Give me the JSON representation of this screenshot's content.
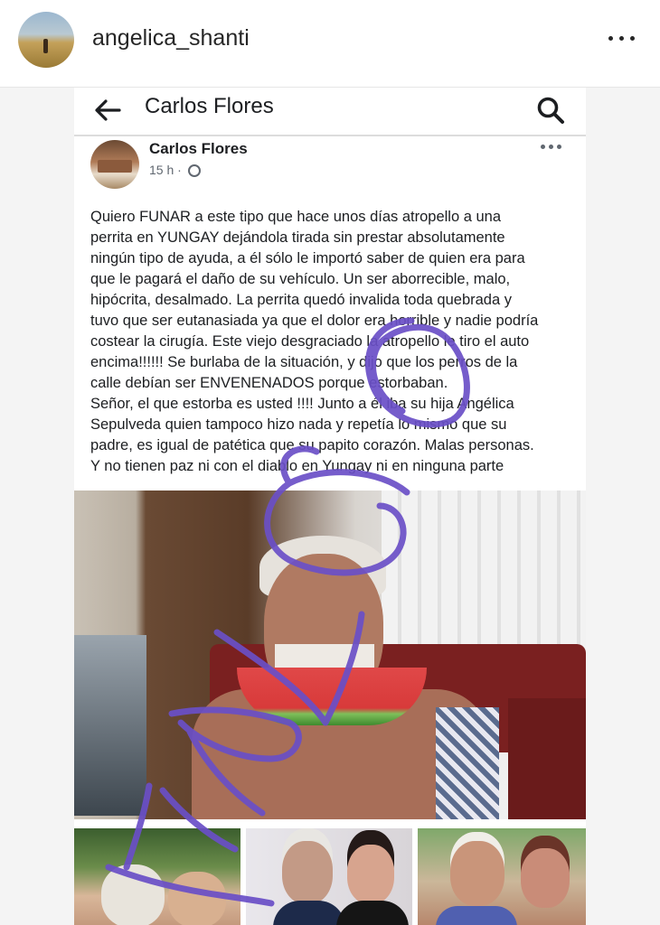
{
  "instagram": {
    "username": "angelica_shanti",
    "more_icon": "more-horizontal-icon"
  },
  "facebook": {
    "header_title": "Carlos Flores",
    "back_icon": "arrow-left-icon",
    "search_icon": "search-icon",
    "post": {
      "author": "Carlos Flores",
      "time": "15 h ·",
      "privacy_icon": "globe-icon",
      "text_lines": [
        "Quiero FUNAR  a este tipo que hace unos días atropello a una",
        "perrita en YUNGAY dejándola tirada sin prestar absolutamente",
        "ningún tipo de ayuda, a él sólo le importó saber de quien era para",
        "que le pagará el daño de su vehículo. Un ser aborrecible, malo,",
        "hipócrita, desalmado. La perrita quedó invalida toda quebrada y",
        "tuvo que ser eutanasiada ya que el dolor era horrible y nadie podría",
        "costear la cirugía. Este viejo desgraciado la atropello le tiro el auto",
        "encima!!!!!!  Se burlaba de la situación, y dijo que los perros de la",
        "calle debían ser ENVENENADOS porque estorbaban.",
        "Señor, el que estorba es usted !!!! Junto a él iba su hija Angélica",
        "Sepulveda quien tampoco hizo nada y repetía lo mismo que su",
        "padre, es igual de patética que su papito corazón. Malas personas.",
        "Y no tienen paz  ni con el diablo en Yungay ni en ninguna parte"
      ]
    }
  },
  "colors": {
    "scribble": "#6a4fc7",
    "text": "#1c1e21",
    "meta": "#606770"
  }
}
